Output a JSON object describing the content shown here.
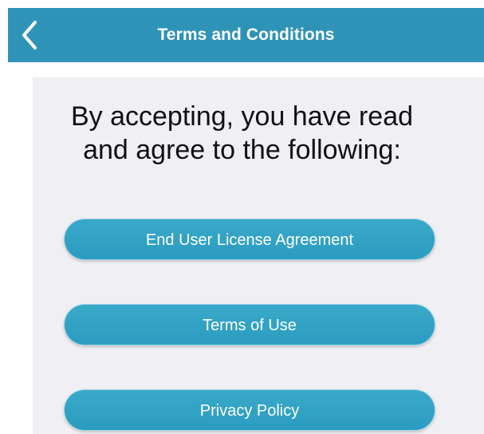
{
  "header": {
    "title": "Terms and Conditions",
    "back_icon": "chevron-left-icon"
  },
  "main": {
    "headline": "By accepting, you have read\nand agree to the following:",
    "buttons": [
      {
        "label": "End User License Agreement"
      },
      {
        "label": "Terms of Use"
      },
      {
        "label": "Privacy Policy"
      }
    ]
  },
  "colors": {
    "navbar": "#2f93b8",
    "button": "#2fa3c6",
    "background": "#efeff4"
  }
}
